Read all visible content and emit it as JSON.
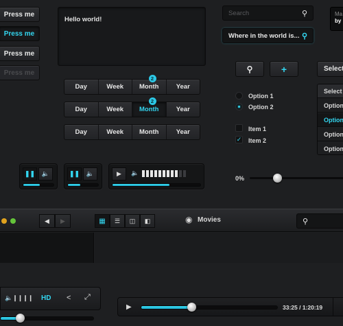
{
  "buttons": {
    "press1": "Press me",
    "press2": "Press me",
    "press3": "Press me",
    "press4": "Press me"
  },
  "textarea": {
    "value": "Hello world!"
  },
  "search1": {
    "placeholder": "Search"
  },
  "search2": {
    "value": "Where in the world is..."
  },
  "corner_card": {
    "line1": "Ma",
    "line2": "by"
  },
  "segments": [
    {
      "items": [
        "Day",
        "Week",
        "Month",
        "Year"
      ],
      "badge": "2",
      "active": ""
    },
    {
      "items": [
        "Day",
        "Week",
        "Month",
        "Year"
      ],
      "badge": "2",
      "active": "Month"
    },
    {
      "items": [
        "Day",
        "Week",
        "Month",
        "Year"
      ],
      "active": ""
    }
  ],
  "select": {
    "label": "Select a",
    "header": "Select a",
    "options": [
      "Option",
      "Option",
      "Option",
      "Option"
    ],
    "highlighted_index": 1
  },
  "radios": [
    {
      "label": "Option 1",
      "checked": false
    },
    {
      "label": "Option 2",
      "checked": true
    }
  ],
  "checks": [
    {
      "label": "Item 1",
      "checked": false
    },
    {
      "label": "Item 2",
      "checked": true
    }
  ],
  "slider": {
    "label": "0%",
    "value": 0.2
  },
  "players": {
    "mini1_progress": 0.55,
    "mini2_progress": 0.4,
    "main_progress": 0.65,
    "volume_bars": 11,
    "volume_on": 2
  },
  "toolbar": {
    "title": "Movies"
  },
  "video": {
    "hd_label": "HD",
    "time": "33:25 / 1:20:19",
    "progress": 0.37
  },
  "colors": {
    "accent": "#33d6f0",
    "bg": "#1e1f21"
  }
}
